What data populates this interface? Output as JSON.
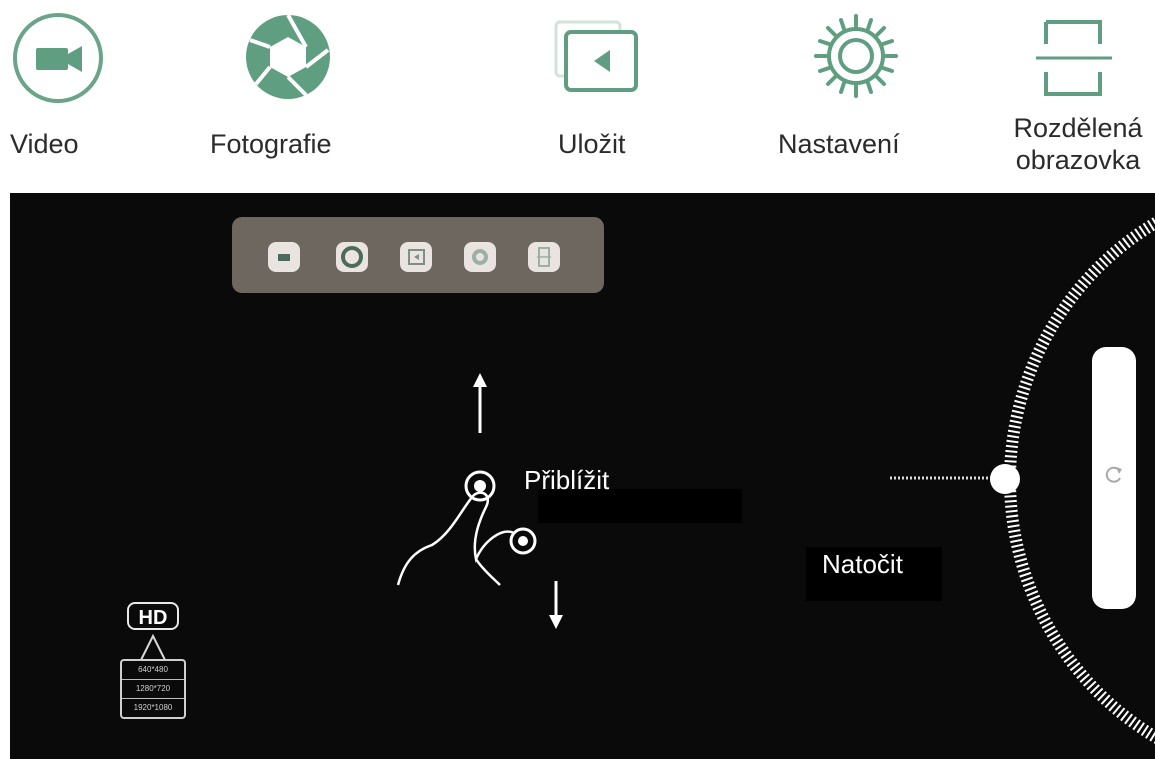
{
  "top_bar": {
    "items": [
      {
        "label": "Video",
        "icon": "video-camera-icon"
      },
      {
        "label": "Fotografie",
        "icon": "camera-shutter-icon"
      },
      {
        "label": "Uložit",
        "icon": "gallery-save-icon"
      },
      {
        "label": "Nastavení",
        "icon": "gear-icon"
      },
      {
        "label_line1": "Rozdělená",
        "label_line2": "obrazovka",
        "icon": "split-screen-icon"
      }
    ],
    "accent_color": "#5f9e80"
  },
  "screen": {
    "zoom_label": "Přiblížit",
    "rotate_label": "Natočit",
    "hd_badge": "HD",
    "resolutions": [
      "640*480",
      "1280*720",
      "1920*1080"
    ]
  }
}
